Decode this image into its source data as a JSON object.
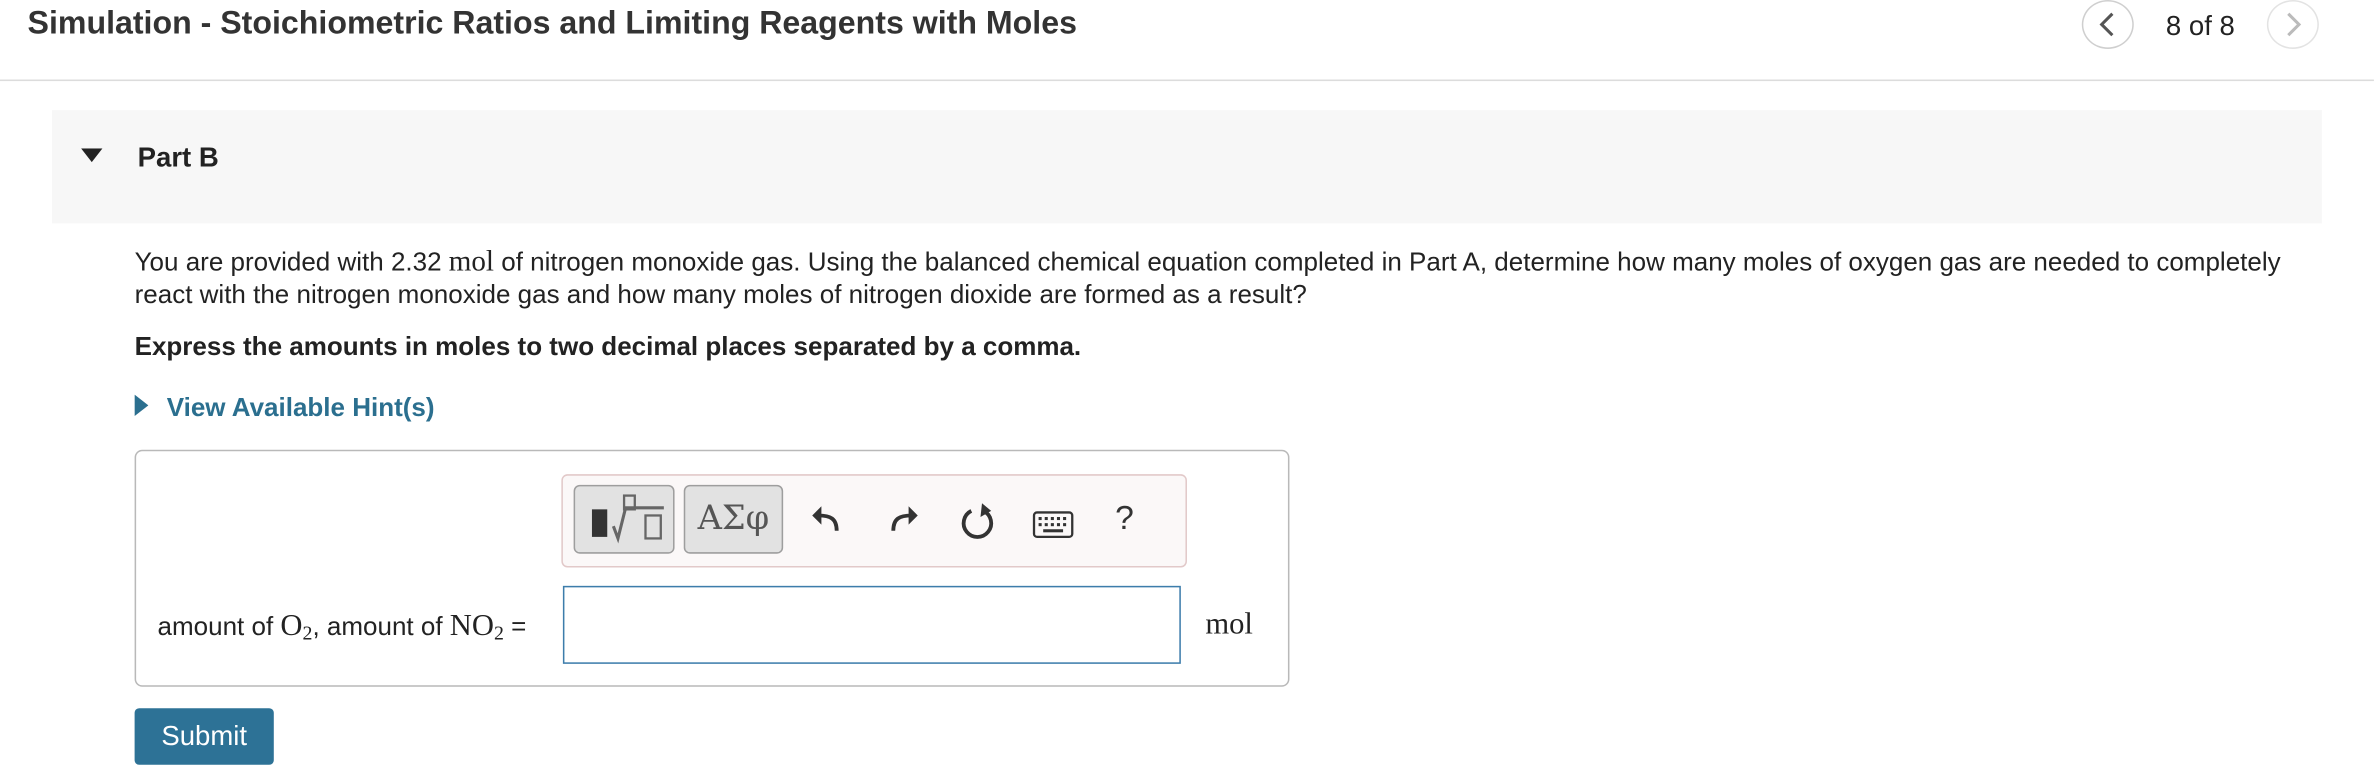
{
  "header": {
    "title": "Simulation - Stoichiometric Ratios and Limiting Reagents with Moles",
    "counter": "8 of 8",
    "prev_icon": "chevron-left-icon",
    "next_icon": "chevron-right-icon"
  },
  "part": {
    "label": "Part B",
    "caret_icon": "caret-down-icon"
  },
  "question": {
    "text_before": "You are provided with 2.32 ",
    "unit": "mol",
    "text_after": " of nitrogen monoxide gas. Using the balanced chemical equation completed in Part A, determine how many moles of oxygen gas are needed to completely react with the nitrogen monoxide gas and how many moles of nitrogen dioxide are formed as a result?",
    "instruction": "Express the amounts in moles to two decimal places separated by a comma."
  },
  "hint": {
    "label": "View Available Hint(s)",
    "caret_icon": "caret-right-icon"
  },
  "toolbar": {
    "templates_icon": "math-templates-icon",
    "greek_label": "ΑΣφ",
    "undo_icon": "undo-icon",
    "redo_icon": "redo-icon",
    "reset_icon": "reset-icon",
    "keyboard_icon": "keyboard-icon",
    "help_label": "?"
  },
  "answer": {
    "label_prefix": "amount of ",
    "o2_base": "O",
    "o2_sub": "2",
    "label_middle": ", amount of ",
    "no2_base": "NO",
    "no2_sub": "2",
    "equals": " =",
    "input_value": "",
    "unit": "mol"
  },
  "submit": {
    "label": "Submit",
    "color": "#2d7296"
  },
  "colors": {
    "link": "#2b6f8f",
    "input_border": "#3d7dab"
  }
}
